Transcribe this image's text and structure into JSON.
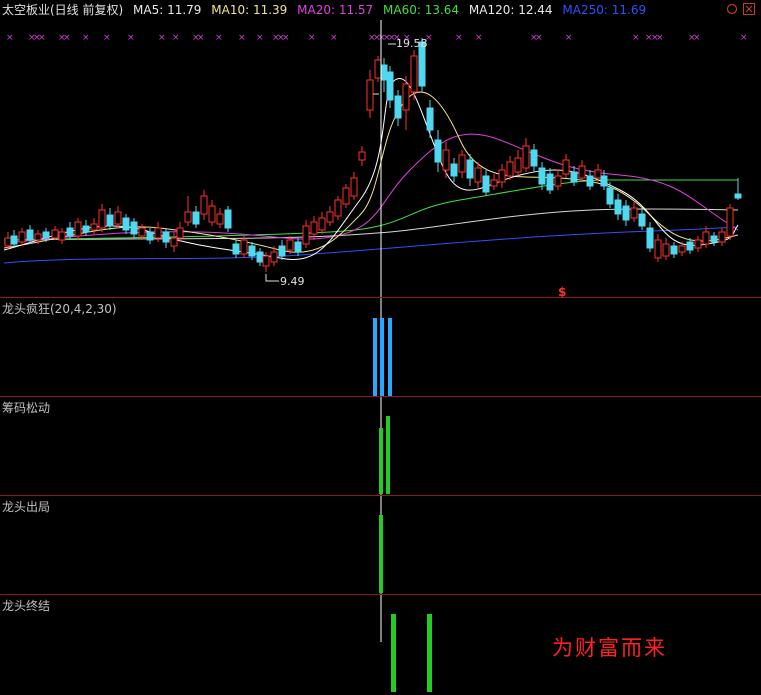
{
  "header": {
    "title": "太空板业(日线 前复权)",
    "ma_items": [
      {
        "label": "MA5: 11.79",
        "color": "#e8e8e8"
      },
      {
        "label": "MA10: 11.39",
        "color": "#f0e68c"
      },
      {
        "label": "MA20: 11.57",
        "color": "#e040e0"
      },
      {
        "label": "MA60: 13.64",
        "color": "#40e040"
      },
      {
        "label": "MA120: 12.44",
        "color": "#e8e8e8"
      },
      {
        "label": "MA250: 11.69",
        "color": "#3050ff"
      }
    ]
  },
  "controls": {
    "zoom_icon": "zoom-circle-icon",
    "close_icon": "close-x-icon"
  },
  "price_chart": {
    "high_label": "19.58",
    "low_label": "9.49",
    "signal_marker": "$"
  },
  "panels": {
    "p1_title": "龙头疯狂(20,4,2,30)",
    "p2_title": "筹码松动",
    "p3_title": "龙头出局",
    "p4_title": "龙头终结"
  },
  "slogan": "为财富而来",
  "colors": {
    "up": "#ff3030",
    "down": "#50d8f0",
    "divider": "#8b1a1a",
    "bar_blue": "#2aa8ff",
    "bar_green": "#22cc22"
  }
}
